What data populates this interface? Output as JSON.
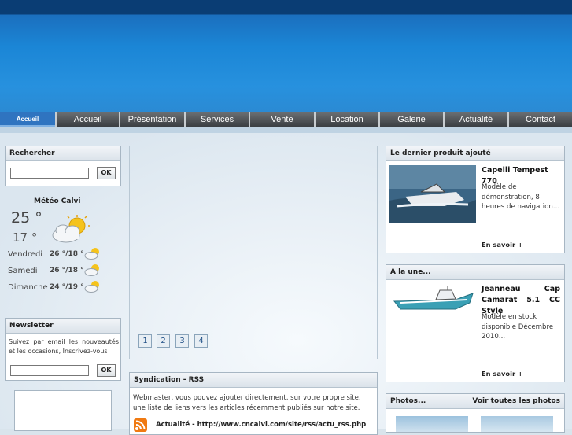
{
  "nav": {
    "items": [
      "Accueil",
      "Accueil",
      "Présentation",
      "Services",
      "Vente",
      "Location",
      "Galerie",
      "Actualité",
      "Contact"
    ]
  },
  "search": {
    "title": "Rechercher",
    "button": "OK",
    "value": ""
  },
  "meteo": {
    "title": "Météo Calvi",
    "today_max": "25 °",
    "today_min": "17 °",
    "days": [
      {
        "name": "Vendredi",
        "temp": "26 °/18 °"
      },
      {
        "name": "Samedi",
        "temp": "26 °/18 °"
      },
      {
        "name": "Dimanche",
        "temp": "24 °/19 °"
      }
    ]
  },
  "newsletter": {
    "title": "Newsletter",
    "text": "Suivez par email les nouveautés et les occasions, Inscrivez-vous",
    "button": "OK"
  },
  "slider": {
    "pages": [
      "1",
      "2",
      "3",
      "4"
    ]
  },
  "rss": {
    "title": "Syndication - RSS",
    "text_line1": "Webmaster, vous pouvez ajouter directement, sur votre propre site,",
    "text_line2": "une liste de liens vers les articles récemment publiés sur notre site.",
    "feed": "Actualité - http://www.cncalvi.com/site/rss/actu_rss.php"
  },
  "last_product": {
    "title": "Le dernier produit ajouté",
    "name": "Capelli  Tempest 770",
    "desc": "Modèle de démonstration, 8 heures de navigation...",
    "more": "En savoir +"
  },
  "a_la_une": {
    "title": "A la une...",
    "name": "Jeanneau  Cap Camarat 5.1 CC Style",
    "desc": "Modèle en stock disponible Décembre 2010...",
    "more": "En savoir +"
  },
  "photos": {
    "title": "Photos...",
    "all": "Voir toutes les photos"
  },
  "colors": {
    "banner": "#1b86d6",
    "nav": "#4a4e52",
    "nav_active": "#2f74c0",
    "panel_header": "#dbe3ea"
  }
}
